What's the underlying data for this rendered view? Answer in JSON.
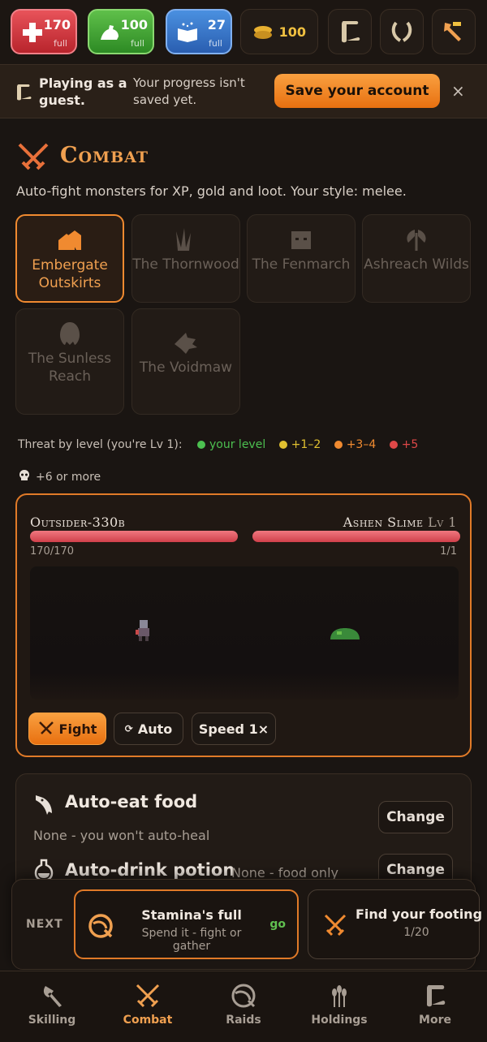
{
  "stats": {
    "hp": {
      "value": "170",
      "sub": "full",
      "icon": "health-cross-icon"
    },
    "strength": {
      "value": "100",
      "sub": "full",
      "icon": "flex-arm-icon"
    },
    "magic": {
      "value": "27",
      "sub": "full",
      "icon": "spellbook-icon"
    },
    "gold": {
      "value": "100",
      "icon": "coins-icon"
    }
  },
  "top_icons": [
    "scroll-icon",
    "laurel-icon",
    "hammer-icon"
  ],
  "banner": {
    "title": "Playing as a guest.",
    "message": "Your progress isn't saved yet.",
    "save_label": "Save your account",
    "close": "×"
  },
  "page": {
    "title": "Combat",
    "description": "Auto-fight monsters for XP, gold and loot. Your style: melee."
  },
  "zones": [
    {
      "name": "Embergate Outskirts",
      "icon": "village-icon",
      "active": true
    },
    {
      "name": "The Thornwood",
      "icon": "grass-icon",
      "active": false
    },
    {
      "name": "The Fenmarch",
      "icon": "ogre-face-icon",
      "active": false
    },
    {
      "name": "Ashreach Wilds",
      "icon": "axe-icon",
      "active": false
    },
    {
      "name": "The Sunless Reach",
      "icon": "wraith-icon",
      "active": false
    },
    {
      "name": "The Voidmaw",
      "icon": "dragon-head-icon",
      "active": false
    }
  ],
  "legend": {
    "label": "Threat by level (you're Lv 1):",
    "items": [
      {
        "text": "your level",
        "color": "#4cc050"
      },
      {
        "text": "+1–2",
        "color": "#e0c030"
      },
      {
        "text": "+3–4",
        "color": "#f08a30"
      },
      {
        "text": "+5",
        "color": "#e04848"
      }
    ],
    "skull_text": "+6 or more"
  },
  "fight": {
    "player_name": "Outsider-330b",
    "player_hp": "170/170",
    "player_hp_fill": 1.0,
    "enemy_name": "Ashen Slime",
    "enemy_level": "Lv 1",
    "enemy_hp": "1/1",
    "enemy_hp_fill": 1.0,
    "fight_label": "Fight",
    "auto_label": "Auto",
    "speed_label": "Speed 1×"
  },
  "settings": {
    "eat_title": "Auto-eat food",
    "eat_value": "None - you won't auto-heal",
    "drink_title": "Auto-drink potion",
    "drink_value": "None - food only",
    "change_label": "Change"
  },
  "tray": {
    "next_label": "NEXT",
    "card1_title": "Stamina's full",
    "card1_sub": "Spend it - fight or gather",
    "card1_go": "go",
    "card2_title": "Find your footing",
    "card2_sub": "1/20"
  },
  "nav": [
    {
      "label": "Skilling",
      "icon": "axe-icon",
      "active": false
    },
    {
      "label": "Combat",
      "icon": "crossed-swords-icon",
      "active": true
    },
    {
      "label": "Raids",
      "icon": "portal-icon",
      "active": false
    },
    {
      "label": "Holdings",
      "icon": "wheat-icon",
      "active": false
    },
    {
      "label": "More",
      "icon": "scroll-icon",
      "active": false
    }
  ],
  "colors": {
    "accent": "#f08a30",
    "hp_bar": "#e05a64",
    "background": "#1a1512"
  }
}
